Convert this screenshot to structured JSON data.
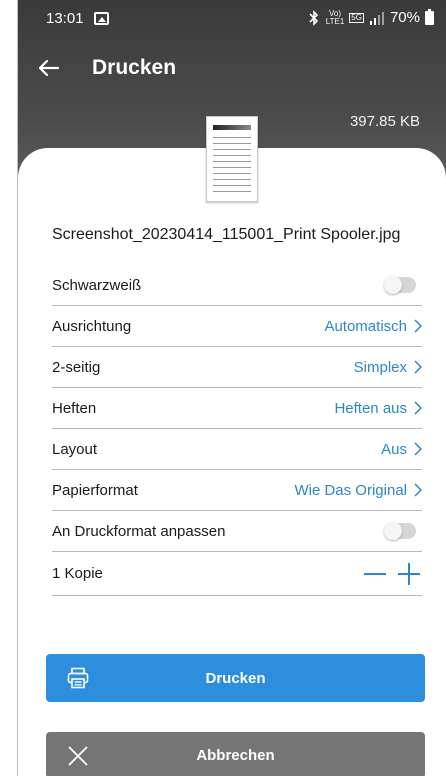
{
  "status_bar": {
    "time": "13:01",
    "volte_top": "Vo)",
    "volte_bottom": "LTE1",
    "signal_5g": "5G",
    "battery": "70%"
  },
  "header": {
    "title": "Drucken",
    "file_size": "397.85 KB"
  },
  "document": {
    "filename": "Screenshot_20230414_115001_Print Spooler.jpg"
  },
  "settings": {
    "color": {
      "label": "Schwarzweiß",
      "enabled": false
    },
    "orientation": {
      "label": "Ausrichtung",
      "value": "Automatisch"
    },
    "duplex": {
      "label": "2-seitig",
      "value": "Simplex"
    },
    "staple": {
      "label": "Heften",
      "value": "Heften aus"
    },
    "layout": {
      "label": "Layout",
      "value": "Aus"
    },
    "paper": {
      "label": "Papierformat",
      "value": "Wie Das Original"
    },
    "fit": {
      "label": "An Druckformat anpassen",
      "enabled": false
    },
    "copies": {
      "label": "1 Kopie"
    }
  },
  "buttons": {
    "print": "Drucken",
    "cancel": "Abbrechen"
  },
  "colors": {
    "accent": "#2b87c9",
    "print_button": "#2e8ede",
    "cancel_button": "#757575",
    "header_bg": "#3a3a3a"
  }
}
